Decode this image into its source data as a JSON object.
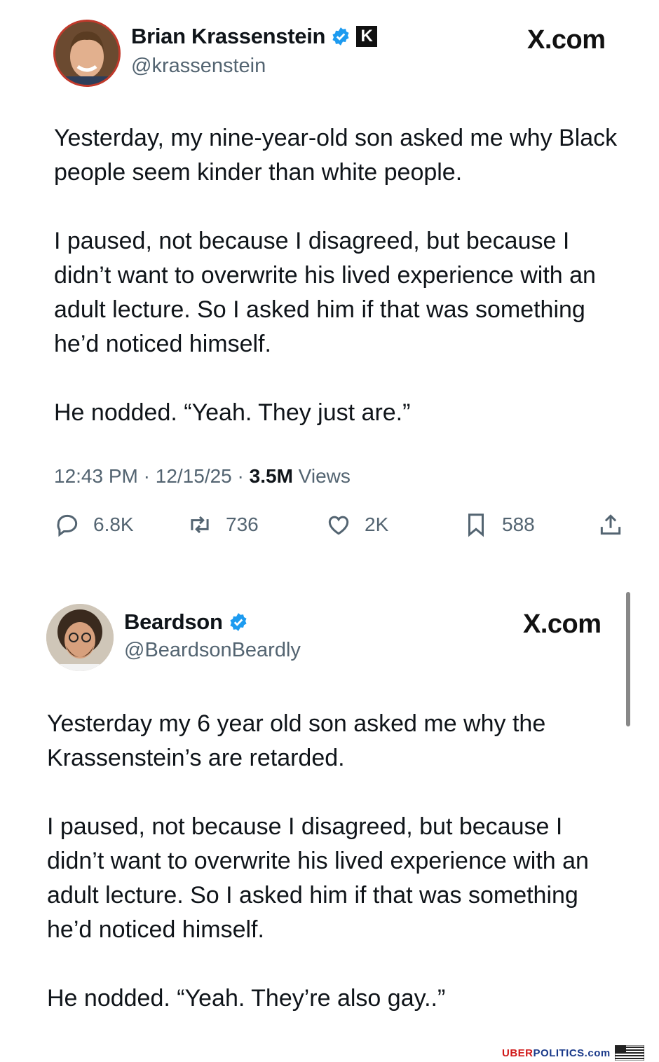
{
  "tweets": [
    {
      "name": "Brian Krassenstein",
      "handle": "@krassenstein",
      "badge_letter": "K",
      "source": "X.com",
      "paragraphs": [
        "Yesterday, my nine-year-old son asked me why Black people seem kinder than white people.",
        "I paused, not because I disagreed, but because I didn’t want to overwrite his lived experience with an adult lecture. So I asked him if that was something he’d noticed himself.",
        "He nodded. “Yeah. They just are.”"
      ],
      "time": "12:43 PM",
      "date": "12/15/25",
      "views_count": "3.5M",
      "views_label": "Views",
      "replies": "6.8K",
      "reposts": "736",
      "likes": "2K",
      "bookmarks": "588"
    },
    {
      "name": "Beardson",
      "handle": "@BeardsonBeardly",
      "source": "X.com",
      "paragraphs": [
        "Yesterday my 6 year old son asked me why the Krassenstein’s are retarded.",
        "I paused, not because I disagreed, but because I didn’t want to overwrite his lived experience with an adult lecture. So I asked him if that was something he’d noticed himself.",
        "He nodded. “Yeah. They’re also gay..”"
      ]
    }
  ],
  "watermark": {
    "part1": "UBER",
    "part2": "POLITICS.com"
  },
  "colors": {
    "verified": "#1d9bf0",
    "muted": "#536471",
    "watermark_red": "#d01818"
  }
}
